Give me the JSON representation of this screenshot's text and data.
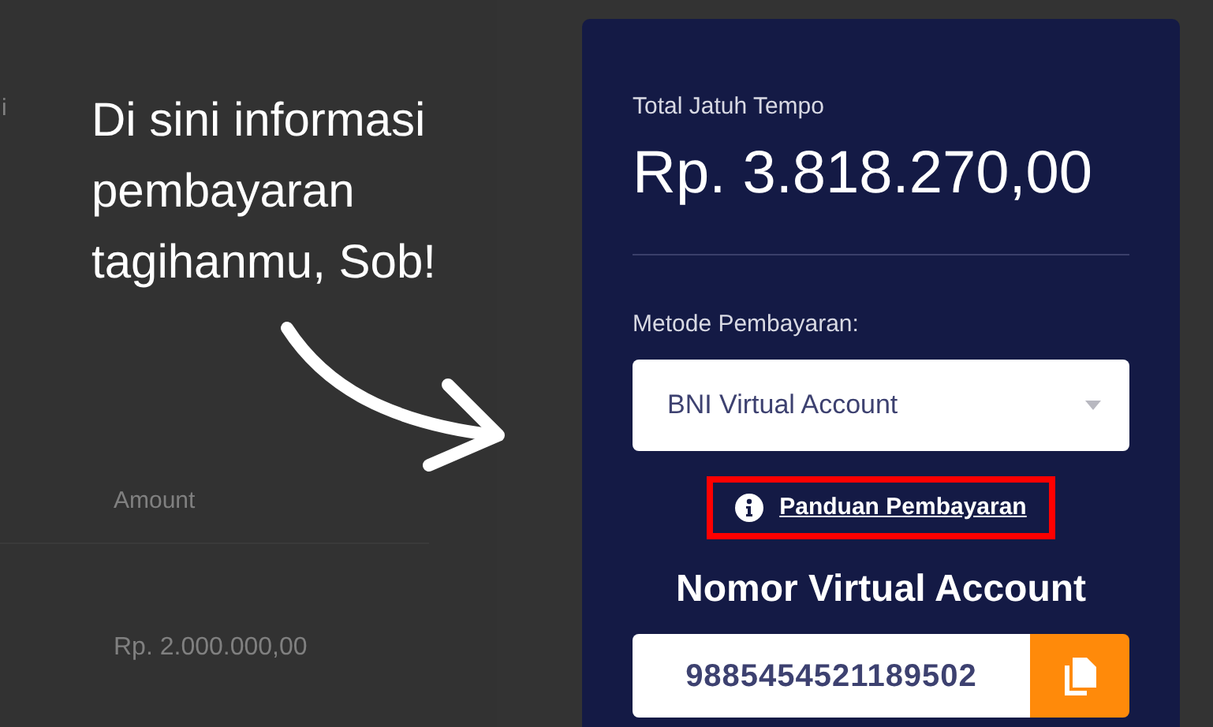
{
  "background_page": {
    "partial_text": "i",
    "table": {
      "columns": [
        "Amount"
      ],
      "rows": [
        [
          "Rp. 2.000.000,00"
        ]
      ]
    }
  },
  "coach_mark": {
    "text": "Di sini informasi pembayaran tagihanmu, Sob!"
  },
  "payment_card": {
    "total_label": "Total Jatuh Tempo",
    "total_amount": "Rp. 3.818.270,00",
    "method_label": "Metode Pembayaran:",
    "method_value": "BNI Virtual Account",
    "guide_link": "Panduan Pembayaran",
    "account_title": "Nomor Virtual Account",
    "account_number": "9885454521189502"
  }
}
